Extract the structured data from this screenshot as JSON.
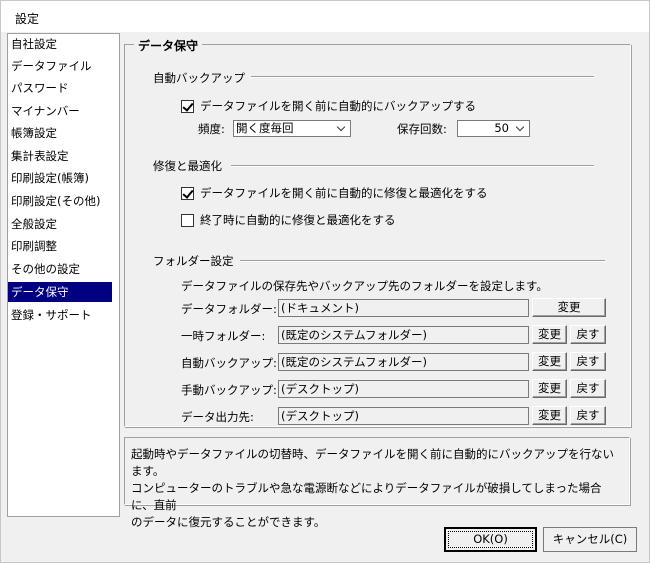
{
  "window": {
    "title": "設定"
  },
  "sidebar": {
    "items": [
      {
        "label": "自社設定"
      },
      {
        "label": "データファイル"
      },
      {
        "label": "パスワード"
      },
      {
        "label": "マイナンバー"
      },
      {
        "label": "帳簿設定"
      },
      {
        "label": "集計表設定"
      },
      {
        "label": "印刷設定(帳簿)"
      },
      {
        "label": "印刷設定(その他)"
      },
      {
        "label": "全般設定"
      },
      {
        "label": "印刷調整"
      },
      {
        "label": "その他の設定"
      },
      {
        "label": "データ保守",
        "selected": true
      },
      {
        "label": "登録・サポート"
      }
    ]
  },
  "panel": {
    "title": "データ保守",
    "auto_backup": {
      "group_label": "自動バックアップ",
      "checkbox_label": "データファイルを開く前に自動的にバックアップする",
      "checked": true,
      "frequency_label": "頻度:",
      "frequency_value": "開く度毎回",
      "count_label": "保存回数:",
      "count_value": "50"
    },
    "repair": {
      "group_label": "修復と最適化",
      "option1_label": "データファイルを開く前に自動的に修復と最適化をする",
      "option1_checked": true,
      "option2_label": "終了時に自動的に修復と最適化をする",
      "option2_checked": false
    },
    "folders": {
      "group_label": "フォルダー設定",
      "intro": "データファイルの保存先やバックアップ先のフォルダーを設定します。",
      "change_label": "変更",
      "reset_label": "戻す",
      "rows": [
        {
          "label": "データフォルダー:",
          "value": "(ドキュメント)"
        },
        {
          "label": "一時フォルダー:",
          "value": "(既定のシステムフォルダー)"
        },
        {
          "label": "自動バックアップ:",
          "value": "(既定のシステムフォルダー)"
        },
        {
          "label": "手動バックアップ:",
          "value": "(デスクトップ)"
        },
        {
          "label": "データ出力先:",
          "value": "(デスクトップ)"
        }
      ]
    }
  },
  "description": {
    "line1": "起動時やデータファイルの切替時、データファイルを開く前に自動的にバックアップを行ないます。",
    "line2": "コンピューターのトラブルや急な電源断などによりデータファイルが破損してしまった場合に、直前",
    "line3": "のデータに復元することができます。"
  },
  "footer": {
    "ok_label": "OK(O)",
    "cancel_label": "キャンセル(C)"
  }
}
